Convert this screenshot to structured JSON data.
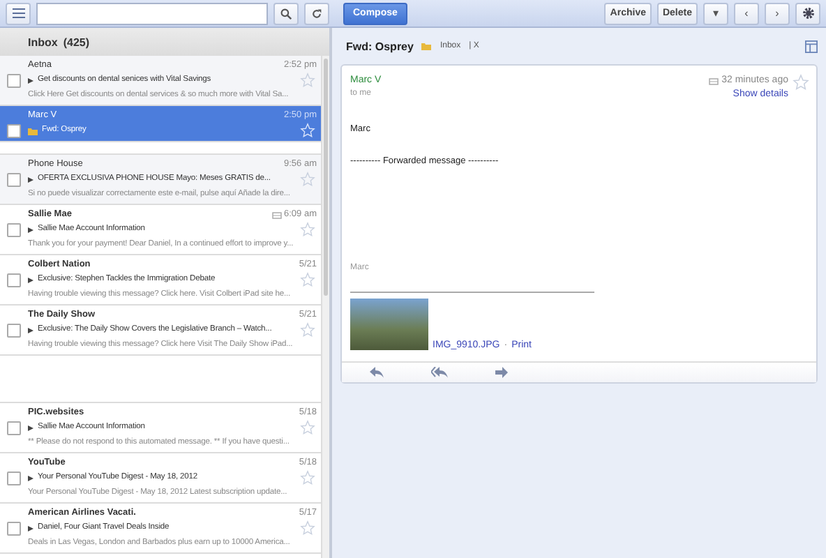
{
  "toolbar": {
    "compose": "Compose",
    "actions": [
      "Archive",
      "Delete"
    ],
    "more": "▾",
    "prev": "‹",
    "next": "›"
  },
  "inbox": {
    "title": "Inbox",
    "count": "(425)"
  },
  "messages": [
    {
      "kind": "email",
      "sender": "Aetna",
      "time": "2:52 pm",
      "subject": "Get discounts on dental senices with Vital Savings",
      "snippet": "Click Here Get discounts on dental services & so much more with Vital Sa...",
      "unread": false,
      "selected": false,
      "starred": false,
      "attachment": false,
      "labeled": false
    },
    {
      "kind": "email",
      "sender": "Marc V",
      "time": "2:50 pm",
      "subject": "Fwd: Osprey",
      "unread": false,
      "selected": true,
      "starred": false,
      "attachment": false,
      "labeled": true
    },
    {
      "kind": "blank"
    },
    {
      "kind": "email",
      "sender": "Phone House",
      "time": "9:56 am",
      "subject": "OFERTA EXCLUSIVA PHONE HOUSE Mayo: Meses GRATIS de...",
      "snippet": "Si no puede visualizar correctamente este e-mail, pulse aquí Añade la dire...",
      "unread": false,
      "selected": false,
      "starred": false,
      "attachment": false,
      "labeled": false
    },
    {
      "kind": "email",
      "sender": "Sallie Mae",
      "time": "6:09 am",
      "subject": "Sallie Mae Account Information",
      "snippet": "Thank you for your payment! Dear Daniel, In a continued effort to improve y...",
      "unread": true,
      "selected": false,
      "starred": false,
      "attachment": true,
      "labeled": false
    },
    {
      "kind": "email",
      "sender": "Colbert Nation",
      "time": "5/21",
      "subject": "Exclusive: Stephen Tackles the Immigration Debate",
      "snippet": "Having trouble viewing this message? Click here. Visit Colbert iPad site he...",
      "unread": true,
      "selected": false,
      "starred": false,
      "attachment": false,
      "labeled": false
    },
    {
      "kind": "email",
      "sender": "The Daily Show",
      "time": "5/21",
      "subject": "Exclusive: The Daily Show Covers the Legislative Branch – Watch...",
      "snippet": "Having trouble viewing this message? Click here Visit The Daily Show iPad...",
      "unread": true,
      "selected": false,
      "starred": false,
      "attachment": false,
      "labeled": false
    },
    {
      "kind": "blank"
    },
    {
      "kind": "email",
      "sender": "PIC.websites",
      "time": "5/18",
      "subject": "Sallie Mae Account Information",
      "snippet": "** Please do not respond to this automated message. ** If you have questi...",
      "unread": true,
      "selected": false,
      "starred": false,
      "attachment": false,
      "labeled": false
    },
    {
      "kind": "email",
      "sender": "YouTube",
      "time": "5/18",
      "subject": "Your Personal YouTube Digest - May 18, 2012",
      "snippet": "Your Personal YouTube Digest - May 18, 2012 Latest subscription update...",
      "unread": true,
      "selected": false,
      "starred": false,
      "attachment": false,
      "labeled": false
    },
    {
      "kind": "email",
      "sender": "American Airlines Vacati.",
      "time": "5/17",
      "subject": "Daniel, Four Giant Travel Deals Inside",
      "snippet": "Deals in Las Vegas, London and Barbados plus earn up to 10000 America...",
      "unread": true,
      "selected": false,
      "starred": false,
      "attachment": false,
      "labeled": false
    }
  ],
  "conversation": {
    "subject": "Fwd: Osprey",
    "label": "Inbox",
    "label_close": "| X",
    "message": {
      "from": "Marc V",
      "to": "to me",
      "time": "32 minutes ago",
      "details": "Show details",
      "starred": false,
      "body": [
        "Marc",
        "---------- Forwarded message ----------"
      ],
      "signature": "Marc",
      "attachment": {
        "name": "IMG_9910.JPG",
        "separator": "·",
        "print": "Print"
      }
    }
  }
}
